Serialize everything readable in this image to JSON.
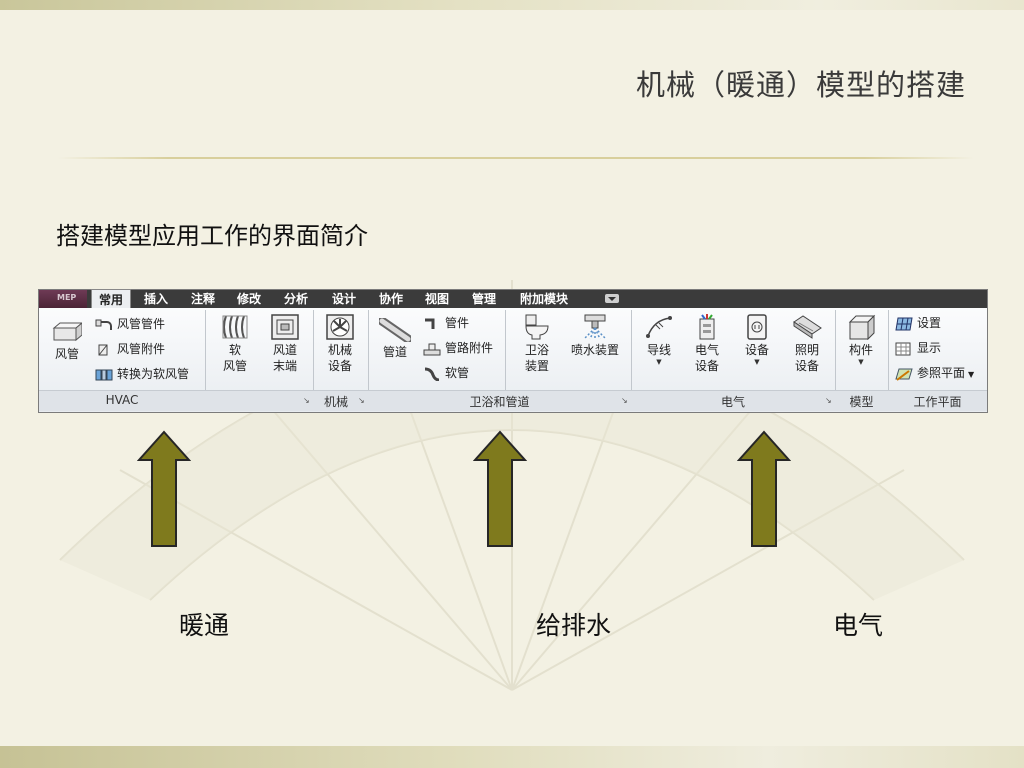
{
  "slide": {
    "title": "机械（暖通）模型的搭建",
    "subtitle": "搭建模型应用工作的界面简介"
  },
  "ribbon": {
    "app_button": "MEP",
    "tabs": [
      "常用",
      "插入",
      "注释",
      "修改",
      "分析",
      "设计",
      "协作",
      "视图",
      "管理",
      "附加模块"
    ],
    "active_tab": "常用",
    "panels": {
      "hvac": {
        "title": "HVAC",
        "duct": "风管",
        "duct_fitting": "风管管件",
        "duct_accessory": "风管附件",
        "convert_flex": "转换为软风管",
        "flex_duct_l1": "软",
        "flex_duct_l2": "风管",
        "air_terminal_l1": "风道",
        "air_terminal_l2": "末端"
      },
      "mechanical": {
        "title": "机械",
        "equip_l1": "机械",
        "equip_l2": "设备"
      },
      "plumbing": {
        "title": "卫浴和管道",
        "pipe": "管道",
        "pipe_fitting": "管件",
        "pipe_accessory": "管路附件",
        "flex_pipe": "软管",
        "fixture_l1": "卫浴",
        "fixture_l2": "装置",
        "sprinkler": "喷水装置"
      },
      "electrical": {
        "title": "电气",
        "wire": "导线",
        "elec_equip_l1": "电气",
        "elec_equip_l2": "设备",
        "device": "设备",
        "lighting_l1": "照明",
        "lighting_l2": "设备"
      },
      "model": {
        "title": "模型",
        "component": "构件"
      },
      "workplane": {
        "title": "工作平面",
        "set": "设置",
        "show": "显示",
        "ref_plane": "参照平面"
      }
    }
  },
  "annotations": {
    "hvac": "暖通",
    "plumbing": "给排水",
    "electrical": "电气"
  },
  "colors": {
    "arrow_fill": "#7f7a1d",
    "arrow_stroke": "#262626",
    "tabbar": "#3b3b3b"
  }
}
